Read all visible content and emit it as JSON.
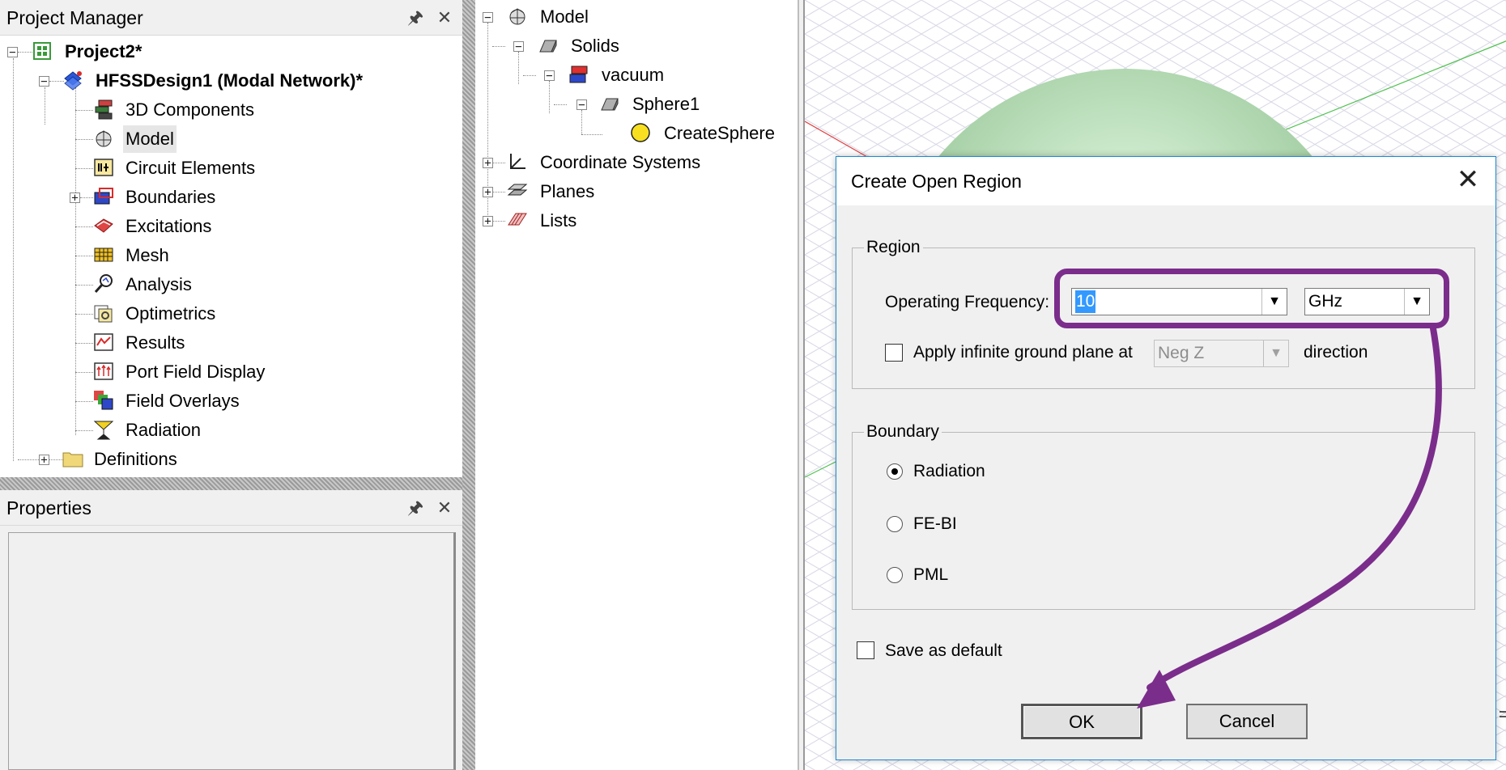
{
  "project_manager": {
    "title": "Project Manager",
    "pin_icon": "pin-icon",
    "close_icon": "close-icon",
    "tree": {
      "project": "Project2*",
      "design": "HFSSDesign1 (Modal Network)*",
      "items": [
        {
          "label": "3D Components",
          "icon": "3d-components-icon"
        },
        {
          "label": "Model",
          "icon": "model-icon"
        },
        {
          "label": "Circuit Elements",
          "icon": "circuit-elements-icon"
        },
        {
          "label": "Boundaries",
          "icon": "boundaries-icon"
        },
        {
          "label": "Excitations",
          "icon": "excitations-icon"
        },
        {
          "label": "Mesh",
          "icon": "mesh-icon"
        },
        {
          "label": "Analysis",
          "icon": "analysis-icon"
        },
        {
          "label": "Optimetrics",
          "icon": "optimetrics-icon"
        },
        {
          "label": "Results",
          "icon": "results-icon"
        },
        {
          "label": "Port Field Display",
          "icon": "port-field-icon"
        },
        {
          "label": "Field Overlays",
          "icon": "field-overlays-icon"
        },
        {
          "label": "Radiation",
          "icon": "radiation-icon"
        }
      ],
      "definitions": "Definitions"
    }
  },
  "properties": {
    "title": "Properties"
  },
  "model_tree": {
    "model": "Model",
    "solids": "Solids",
    "material": "vacuum",
    "object": "Sphere1",
    "operation": "CreateSphere",
    "coordinate_systems": "Coordinate Systems",
    "planes": "Planes",
    "lists": "Lists"
  },
  "dialog": {
    "title": "Create Open Region",
    "region_group": "Region",
    "operating_frequency_label": "Operating Frequency:",
    "frequency_value": "10",
    "frequency_unit": "GHz",
    "ground_plane_label": "Apply infinite ground plane at",
    "ground_plane_value": "Neg Z",
    "direction_label": "direction",
    "boundary_group": "Boundary",
    "boundary_options": [
      "Radiation",
      "FE-BI",
      "PML"
    ],
    "boundary_selected": "Radiation",
    "save_default_label": "Save as default",
    "ok_label": "OK",
    "cancel_label": "Cancel"
  },
  "colors": {
    "annotation": "#7b2d8b",
    "selection": "#3399ff",
    "sphere": "#a9d3a9",
    "dialog_border": "#1a8ad4"
  }
}
